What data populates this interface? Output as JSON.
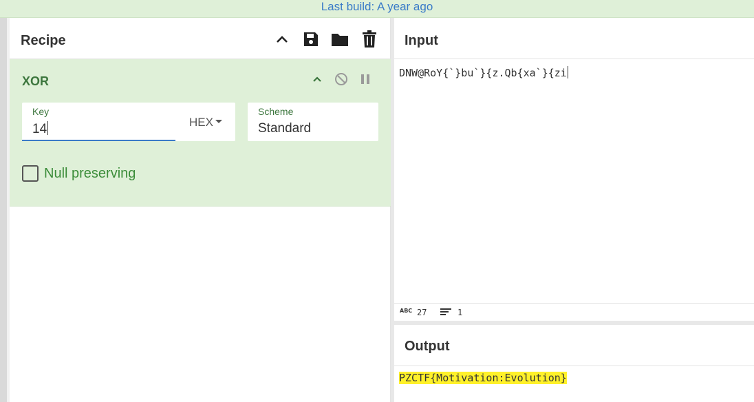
{
  "banner": {
    "text": "Last build: A year ago"
  },
  "recipe": {
    "title": "Recipe",
    "icons": [
      "chevron-up-icon",
      "save-icon",
      "folder-icon",
      "trash-icon"
    ],
    "operation": {
      "name": "XOR",
      "key": {
        "label": "Key",
        "value": "14",
        "format": "HEX"
      },
      "scheme": {
        "label": "Scheme",
        "value": "Standard"
      },
      "null_preserving": {
        "label": "Null preserving",
        "checked": false
      }
    }
  },
  "input": {
    "title": "Input",
    "text": "DNW@RoY{`}bu`}{z.Qb{xa`}{zi",
    "status": {
      "chars_icon": "ABC",
      "chars": "27",
      "lines": "1"
    }
  },
  "output": {
    "title": "Output",
    "text": "PZCTF{Motivation:Evolution}"
  },
  "colors": {
    "accent_green": "#3c763d",
    "op_background": "#dff0d8",
    "link_blue": "#3a7bc8",
    "highlight": "#fff12a"
  }
}
